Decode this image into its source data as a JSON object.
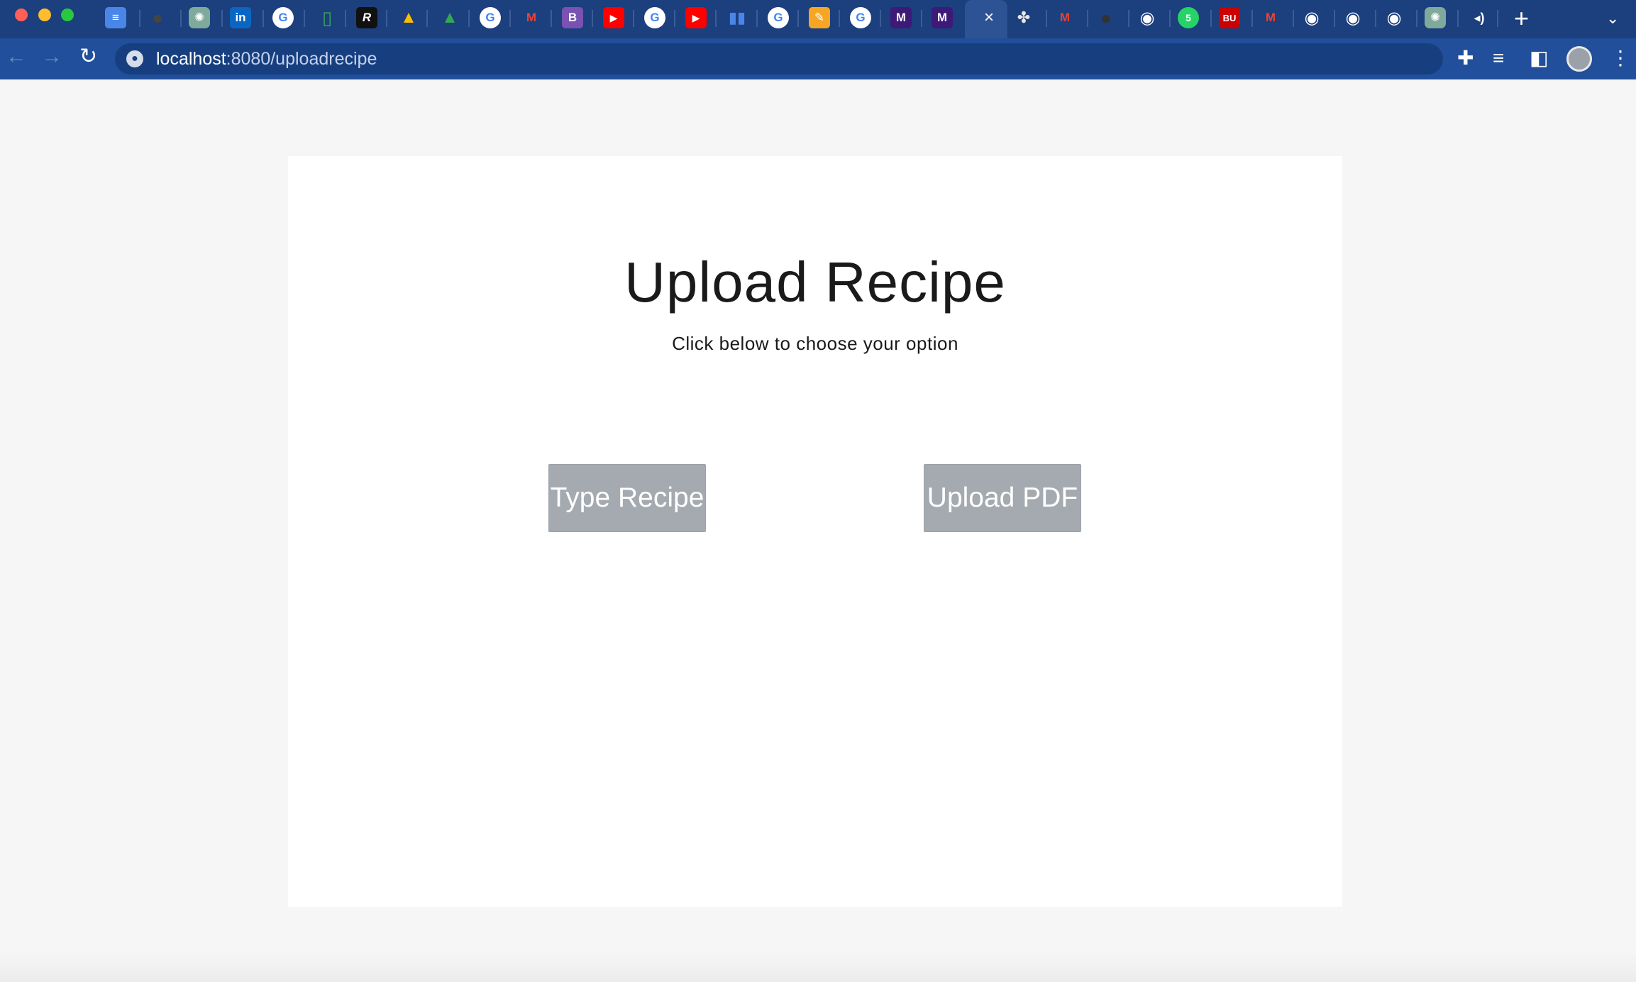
{
  "browser": {
    "tab_icons": [
      "docs-icon",
      "github-icon",
      "chatgpt-icon",
      "linkedin-icon",
      "google-icon",
      "sheet-icon",
      "r-icon",
      "drive-icon",
      "drive-icon",
      "google-icon",
      "gmail-icon",
      "bootstrap-icon",
      "youtube-icon",
      "google-icon",
      "youtube-icon",
      "analytics-icon",
      "google-icon",
      "notes-icon",
      "google-icon",
      "m-icon",
      "m-icon"
    ],
    "tab_icons_right": [
      "apps-icon",
      "gmail-icon",
      "github-icon",
      "chrome-icon",
      "whatsapp-icon",
      "bu-icon",
      "gmail-icon",
      "chrome-icon",
      "chrome-icon",
      "chrome-icon",
      "chatgpt-icon",
      "audio-icon"
    ],
    "active_tab_close": "×",
    "new_tab": "+",
    "url_host": "localhost",
    "url_path": ":8080/uploadrecipe",
    "accent": "#1c3f7d"
  },
  "page": {
    "title": "Upload Recipe",
    "subtitle": "Click below to choose your option",
    "buttons": {
      "type_recipe": "Type Recipe",
      "upload_pdf": "Upload PDF"
    },
    "button_color": "#a5aab0"
  }
}
